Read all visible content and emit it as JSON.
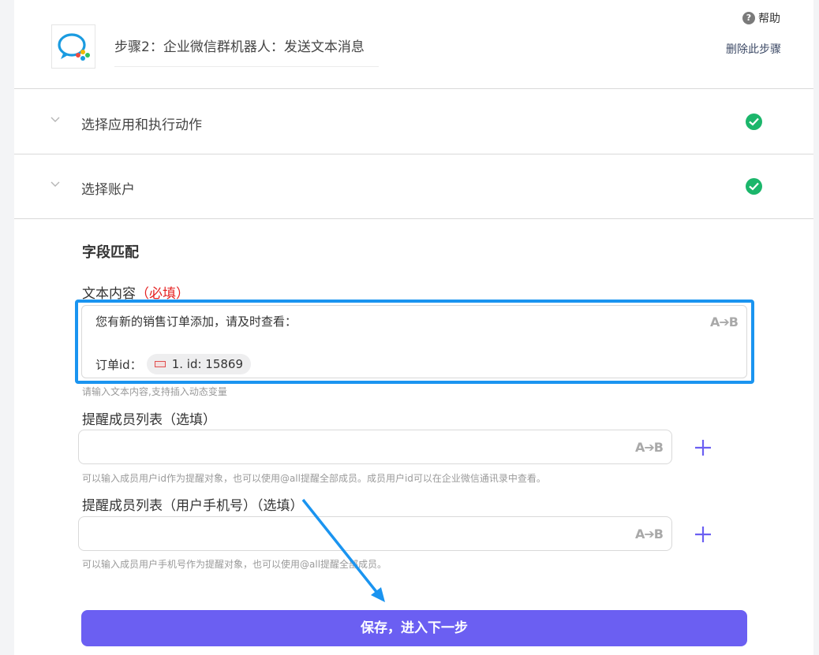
{
  "header": {
    "step_title": "步骤2：企业微信群机器人：发送文本消息",
    "help_label": "帮助",
    "help_icon": "?",
    "delete_label": "删除此步骤"
  },
  "sections": [
    {
      "label": "选择应用和执行动作",
      "status": "complete"
    },
    {
      "label": "选择账户",
      "status": "complete"
    }
  ],
  "field_mapping": {
    "title": "字段匹配",
    "text_content": {
      "label": "文本内容",
      "required_mark": "（必填）",
      "line1": "您有新的销售订单添加，请及时查看：",
      "line2_prefix": "订单id：",
      "variable_tag": "1. id: 15869",
      "hint": "请输入文本内容,支持插入动态变量",
      "ab_label": "A➔B"
    },
    "mention_list": {
      "label": "提醒成员列表（选填）",
      "value": "",
      "hint": "可以输入成员用户id作为提醒对象，也可以使用@all提醒全部成员。成员用户id可以在企业微信通讯录中查看。",
      "ab_label": "A➔B"
    },
    "mention_mobile_list": {
      "label": "提醒成员列表（用户手机号）（选填）",
      "value": "",
      "hint": "可以输入成员用户手机号作为提醒对象，也可以使用@all提醒全部成员。",
      "ab_label": "A➔B"
    }
  },
  "save_button": "保存，进入下一步",
  "colors": {
    "accent": "#6b5ff2",
    "success": "#1bb66b",
    "highlight": "#1a94f0",
    "required": "#e52222"
  }
}
